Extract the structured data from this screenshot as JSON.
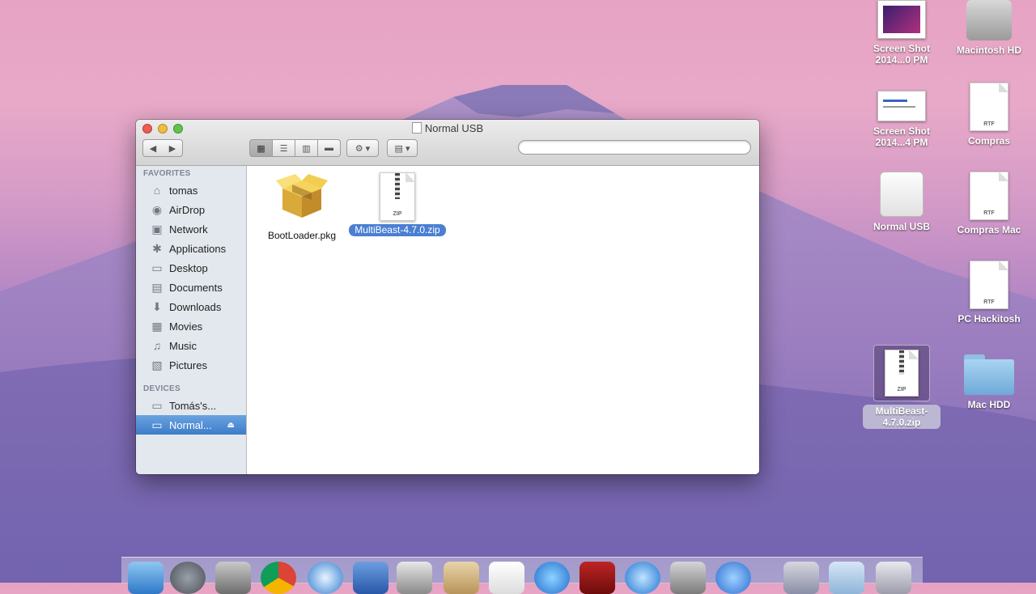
{
  "desktop": {
    "icons": [
      {
        "label": "Screen Shot 2014...0 PM"
      },
      {
        "label": "Macintosh HD"
      },
      {
        "label": "Screen Shot 2014...4 PM"
      },
      {
        "label": "Compras"
      },
      {
        "label": "Normal USB"
      },
      {
        "label": "Compras Mac"
      },
      {
        "label": "PC Hackitosh"
      },
      {
        "label": "MultiBeast-4.7.0.zip"
      },
      {
        "label": "Mac HDD"
      }
    ],
    "doc_tag": "RTF",
    "zip_tag": "ZIP"
  },
  "window": {
    "title": "Normal USB",
    "search_placeholder": "",
    "nav_back": "◀",
    "nav_forward": "▶",
    "sidebar": {
      "favorites_header": "FAVORITES",
      "favorites": [
        {
          "label": "tomas",
          "icon": "home-icon"
        },
        {
          "label": "AirDrop",
          "icon": "airdrop-icon"
        },
        {
          "label": "Network",
          "icon": "network-icon"
        },
        {
          "label": "Applications",
          "icon": "applications-icon"
        },
        {
          "label": "Desktop",
          "icon": "desktop-icon"
        },
        {
          "label": "Documents",
          "icon": "documents-icon"
        },
        {
          "label": "Downloads",
          "icon": "downloads-icon"
        },
        {
          "label": "Movies",
          "icon": "movies-icon"
        },
        {
          "label": "Music",
          "icon": "music-icon"
        },
        {
          "label": "Pictures",
          "icon": "pictures-icon"
        }
      ],
      "devices_header": "DEVICES",
      "devices": [
        {
          "label": "Tomás's..."
        },
        {
          "label": "Normal..."
        }
      ]
    },
    "files": [
      {
        "label": "BootLoader.pkg"
      },
      {
        "label": "MultiBeast-4.7.0.zip"
      }
    ]
  },
  "colors": {
    "selection": "#4a7fd3",
    "sidebar_bg": "#e3e8ee",
    "close": "#ee5b52",
    "minimize": "#f2bc3f",
    "zoom": "#5fc447"
  }
}
